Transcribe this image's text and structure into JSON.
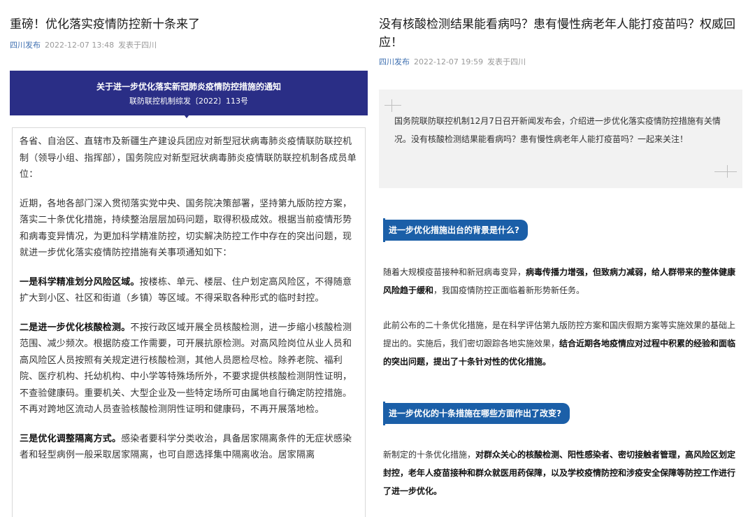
{
  "left": {
    "title": "重磅！优化落实疫情防控新十条来了",
    "author": "四川发布",
    "time": "2022-12-07 13:48",
    "location": "发表于四川",
    "banner": {
      "title": "关于进一步优化落实新冠肺炎疫情防控措施的通知",
      "doc_no": "联防联控机制综发〔2022〕113号"
    },
    "paragraphs": [
      {
        "bold": "",
        "text": "各省、自治区、直辖市及新疆生产建设兵团应对新型冠状病毒肺炎疫情联防联控机制（领导小组、指挥部），国务院应对新型冠状病毒肺炎疫情联防联控机制各成员单位："
      },
      {
        "bold": "",
        "text": "近期，各地各部门深入贯彻落实党中央、国务院决策部署，坚持第九版防控方案，落实二十条优化措施，持续整治层层加码问题，取得积极成效。根据当前疫情形势和病毒变异情况，为更加科学精准防控，切实解决防控工作中存在的突出问题，现就进一步优化落实疫情防控措施有关事项通知如下："
      },
      {
        "bold": "一是科学精准划分风险区域。",
        "text": "按楼栋、单元、楼层、住户划定高风险区，不得随意扩大到小区、社区和街道（乡镇）等区域。不得采取各种形式的临时封控。"
      },
      {
        "bold": "二是进一步优化核酸检测。",
        "text": "不按行政区域开展全员核酸检测，进一步缩小核酸检测范围、减少频次。根据防疫工作需要，可开展抗原检测。对高风险岗位从业人员和高风险区人员按照有关规定进行核酸检测，其他人员愿检尽检。除养老院、福利院、医疗机构、托幼机构、中小学等特殊场所外，不要求提供核酸检测阴性证明，不查验健康码。重要机关、大型企业及一些特定场所可由属地自行确定防控措施。不再对跨地区流动人员查验核酸检测阴性证明和健康码，不再开展落地检。"
      },
      {
        "bold": "三是优化调整隔离方式。",
        "text": "感染者要科学分类收治，具备居家隔离条件的无症状感染者和轻型病例一般采取居家隔离，也可自愿选择集中隔离收治。居家隔离"
      }
    ]
  },
  "right": {
    "title": "没有核酸检测结果能看病吗？患有慢性病老年人能打疫苗吗？权威回应！",
    "author": "四川发布",
    "time": "2022-12-07 19:59",
    "location": "发表于四川",
    "quote": "国务院联防联控机制12月7日召开新闻发布会，介绍进一步优化落实疫情防控措施有关情况。没有核酸检测结果能看病吗？患有慢性病老年人能打疫苗吗？一起来关注！",
    "section1_heading": "进一步优化措施出台的背景是什么?",
    "p1": {
      "a": "随着大规模疫苗接种和新冠病毒变异，",
      "b": "病毒传播力增强，但致病力减弱，给人群带来的整体健康风险趋于缓和",
      "c": "，我国疫情防控正面临着新形势新任务。"
    },
    "p2": {
      "a": "此前公布的二十条优化措施，是在科学评估第九版防控方案和国庆假期方案等实施效果的基础上提出的。实施后，我们密切跟踪各地实施效果，",
      "b": "结合近期各地疫情应对过程中积累的经验和面临的突出问题，提出了十条针对性的优化措施。",
      "c": ""
    },
    "section2_heading": "进一步优化的十条措施在哪些方面作出了改变?",
    "p3": {
      "a": "新制定的十条优化措施，",
      "b": "对群众关心的核酸检测、阳性感染者、密切接触者管理，高风险区划定封控，老年人疫苗接种和群众就医用药保障，以及学校疫情防控和涉疫安全保障等防控工作进行了进一步优化。",
      "c": ""
    }
  }
}
